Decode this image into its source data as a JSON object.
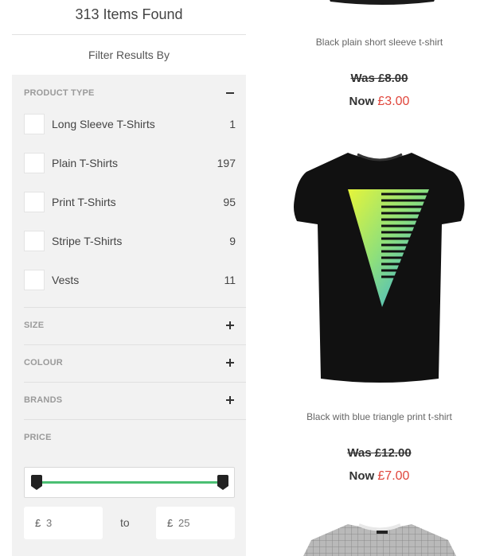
{
  "header": {
    "items_found": "313 Items Found",
    "filter_by": "Filter Results By"
  },
  "filters": {
    "product_type": {
      "title": "PRODUCT TYPE",
      "options": [
        {
          "label": "Long Sleeve T-Shirts",
          "count": "1"
        },
        {
          "label": "Plain T-Shirts",
          "count": "197"
        },
        {
          "label": "Print T-Shirts",
          "count": "95"
        },
        {
          "label": "Stripe T-Shirts",
          "count": "9"
        },
        {
          "label": "Vests",
          "count": "11"
        }
      ]
    },
    "size": {
      "title": "SIZE"
    },
    "colour": {
      "title": "COLOUR"
    },
    "brands": {
      "title": "BRANDS"
    },
    "price": {
      "title": "PRICE",
      "currency": "£",
      "min_placeholder": "3",
      "max_placeholder": "25",
      "to": "to",
      "range_min": 3,
      "range_max": 25,
      "slider_accent": "#4bbf73"
    }
  },
  "products": [
    {
      "name": "Black plain short sleeve t-shirt",
      "was": "Was £8.00",
      "now_label": "Now",
      "now_price": "£3.00"
    },
    {
      "name": "Black with blue triangle print t-shirt",
      "was": "Was £12.00",
      "now_label": "Now",
      "now_price": "£7.00"
    }
  ],
  "colors": {
    "sale_price": "#e0453b",
    "panel_bg": "#f2f2f2"
  }
}
